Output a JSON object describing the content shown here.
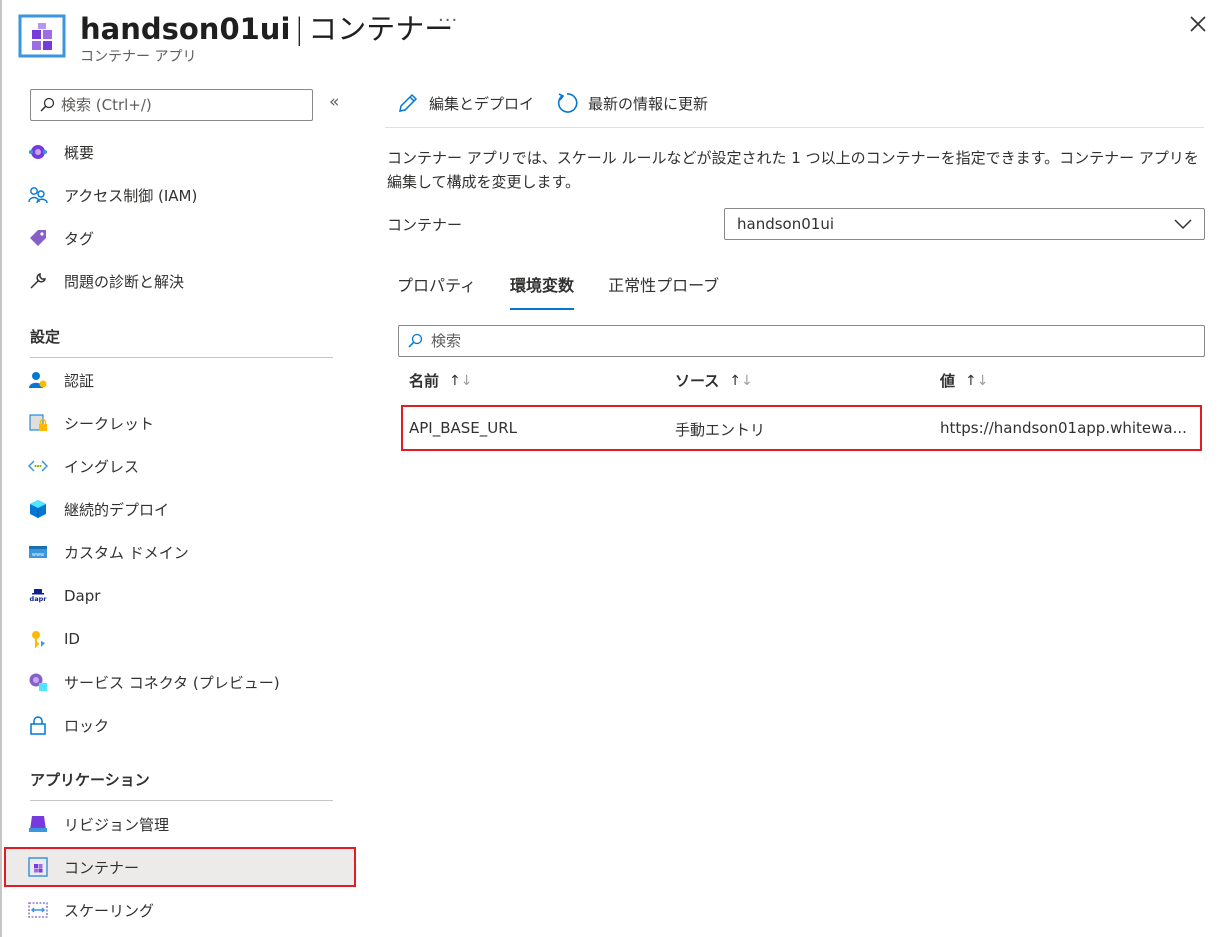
{
  "header": {
    "title": "handson01ui",
    "separator": "|",
    "section": "コンテナー",
    "subtitle": "コンテナー アプリ",
    "more": "···"
  },
  "sidebar": {
    "search_placeholder": "検索 (Ctrl+/)",
    "collapse": "«",
    "items_top": [
      {
        "label": "概要",
        "icon": "overview-icon"
      },
      {
        "label": "アクセス制御 (IAM)",
        "icon": "iam-people-icon"
      },
      {
        "label": "タグ",
        "icon": "tag-icon"
      },
      {
        "label": "問題の診断と解決",
        "icon": "wrench-icon"
      }
    ],
    "settings_header": "設定",
    "items_settings": [
      {
        "label": "認証",
        "icon": "auth-user-icon"
      },
      {
        "label": "シークレット",
        "icon": "secret-icon"
      },
      {
        "label": "イングレス",
        "icon": "ingress-icon"
      },
      {
        "label": "継続的デプロイ",
        "icon": "deploy-cube-icon"
      },
      {
        "label": "カスタム ドメイン",
        "icon": "domain-icon"
      },
      {
        "label": "Dapr",
        "icon": "dapr-icon"
      },
      {
        "label": "ID",
        "icon": "identity-key-icon"
      },
      {
        "label": "サービス コネクタ (プレビュー)",
        "icon": "service-connector-icon"
      },
      {
        "label": "ロック",
        "icon": "lock-icon"
      }
    ],
    "application_header": "アプリケーション",
    "items_application": [
      {
        "label": "リビジョン管理",
        "icon": "revision-icon"
      },
      {
        "label": "コンテナー",
        "icon": "container-icon",
        "selected": true
      },
      {
        "label": "スケーリング",
        "icon": "scale-icon"
      }
    ]
  },
  "toolbar": {
    "edit_deploy": "編集とデプロイ",
    "refresh": "最新の情報に更新"
  },
  "main": {
    "description": "コンテナー アプリでは、スケール ルールなどが設定された 1 つ以上のコンテナーを指定できます。コンテナー アプリを編集して構成を変更します。",
    "container_label": "コンテナー",
    "container_selected": "handson01ui",
    "tabs": [
      "プロパティ",
      "環境変数",
      "正常性プローブ"
    ],
    "active_tab": "環境変数",
    "filter_placeholder": "検索",
    "columns": [
      "名前",
      "ソース",
      "値"
    ],
    "sort_up": "↑",
    "sort_down": "↓",
    "rows": [
      {
        "name": "API_BASE_URL",
        "source": "手動エントリ",
        "value": "https://handson01app.whitewa..."
      }
    ]
  },
  "colors": {
    "accent": "#0078d4",
    "highlight": "#e01d24",
    "selected_bg": "#edebe9"
  }
}
